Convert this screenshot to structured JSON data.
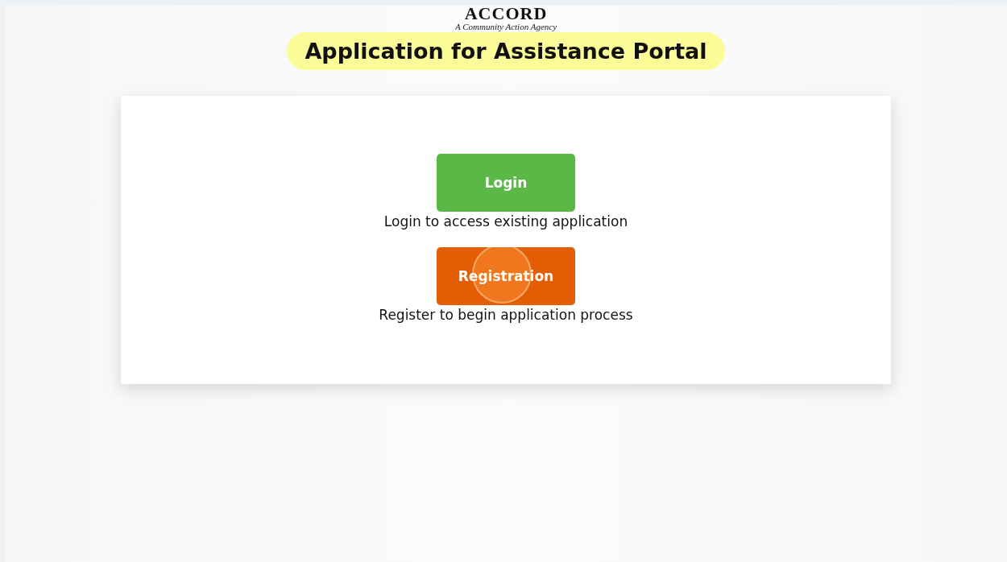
{
  "logo": {
    "name": "ACCORD",
    "tagline": "A Community Action Agency"
  },
  "title": "Application for Assistance Portal",
  "actions": [
    {
      "label": "Login",
      "color": "#5bb847",
      "description": "Login to access existing application"
    },
    {
      "label": "Registration",
      "color": "#e35d05",
      "description": "Register to begin application process"
    }
  ]
}
